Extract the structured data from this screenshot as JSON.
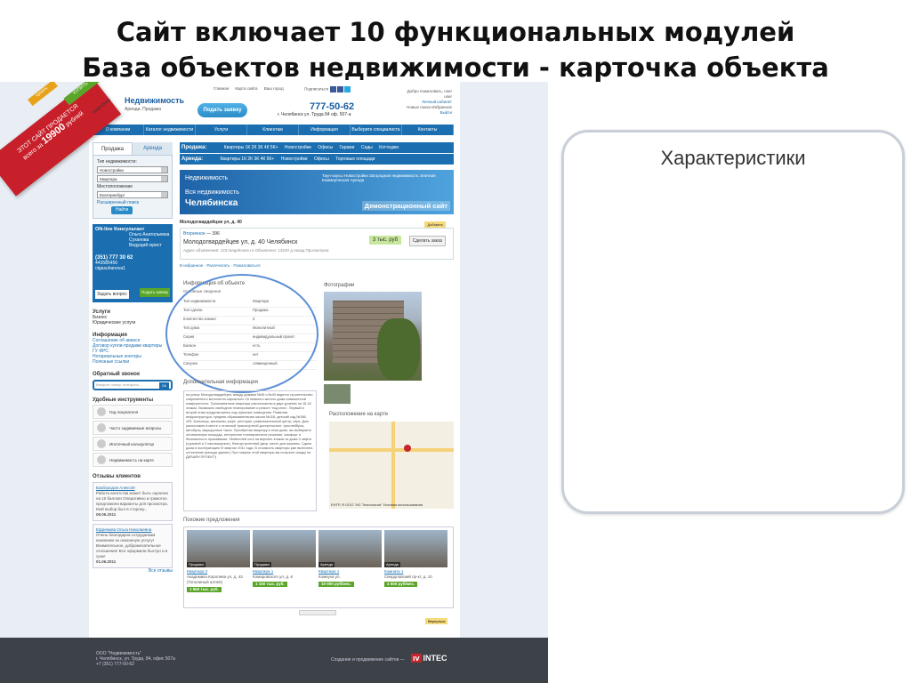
{
  "slide": {
    "title_line1": "Сайт включает 10 функциональных модулей",
    "title_line2": "База объектов недвижимости - карточка объекта",
    "right_panel_title": "Характеристики"
  },
  "site": {
    "promo_text_top": "ЭТОТ САЙТ ПРОДАЕТСЯ",
    "promo_text_mid": "всего за",
    "promo_price": "19900",
    "promo_price_unit": "рублей",
    "promo_btn_buy": "КУПИТЬ",
    "promo_btn_more": "подробнее",
    "promo_btn_green": "купить",
    "logo": "Недвижимость",
    "logo_sub": "Аренда. Продажа",
    "order_button": "Подать заявку",
    "top_links": [
      "Главная",
      "Карта сайта",
      "Ваш город"
    ],
    "social_label": "Подписаться",
    "phone": "777-50-62",
    "address": "г. Челябинск ул. Труда 84 оф. 507-а",
    "user_greeting": "Добро пожаловать, user",
    "user_name": "user",
    "user_links": [
      "Личный кабинет",
      "Новые поиск",
      "Избранное",
      "Выйти"
    ],
    "nav": [
      "О компании",
      "Каталог недвижимости",
      "Услуги",
      "Клиентам",
      "Информация",
      "Выберите специалиста",
      "Контакты"
    ],
    "tabs": {
      "sale": "Продажа",
      "rent": "Аренда"
    },
    "filters": {
      "type_label": "Тип недвижимости:",
      "type_value": "Новостройки",
      "kind_value": "Квартира",
      "location_label": "Местоположение",
      "location_value": "Екатеринбург",
      "advanced_link": "Расширенный поиск",
      "find_button": "Найти"
    },
    "online": {
      "title": "ON-line Консультант",
      "name": "Ольга Анатольевна Суханова",
      "position": "Ведущий юрист",
      "phone": "(351) 777 30 62",
      "icq": "443585456",
      "skype": "olgasuhanova1",
      "question_label": "Задать вопрос",
      "apply_label": "Подать заявку"
    },
    "services_title": "Услуги",
    "services": [
      "Бизнес",
      "Юридические услуги"
    ],
    "info_title": "Информация",
    "info_links": [
      "Соглашение об авансе",
      "Договор купли-продажи квартиры",
      "ГУ ФРС",
      "Нотариальные конторы",
      "Полезные ссылки"
    ],
    "callback_title": "Обратный звонок",
    "callback_placeholder": "Введите номер телефона...",
    "callback_btn": "Ok",
    "tools_title": "Удобные инструменты",
    "tools": [
      "Гид покупателя",
      "Часто задаваемые вопросы",
      "Ипотечный калькулятор",
      "Недвижимость на карте"
    ],
    "reviews_title": "Отзывы клиентов",
    "review1_name": "Базбородов Алексей",
    "review1_text": "Работа агентства может быть оценена на 10 баллов! Оперативно и грамотно предложили варианты для просмотра. Мой выбор был в сторону...",
    "review1_date": "09.06.2011",
    "review2_name": "Ефремова Ольга Николаевна",
    "review2_text": "Очень благодарна сотрудникам компании за оказанную услугу! Внимательное, доброжелательное отношение! Все оформили быстро и в срок!",
    "review2_date": "01.06.2011",
    "all_reviews": "Все отзывы",
    "deals": {
      "sale_label": "Продажа:",
      "rent_label": "Аренда:",
      "rooms": "Квартиры 1К 2К 3К 4К 5К+",
      "sale_extra": [
        "Новостройки",
        "Офисы",
        "Гаражи",
        "Сады",
        "Коттеджи"
      ],
      "rent_extra": [
        "Новостройки",
        "Офисы",
        "Торговые площади"
      ]
    },
    "banner": {
      "brand": "Недвижимость",
      "line1": "Вся недвижимость",
      "line2": "Челябинска",
      "demo": "Демонстрационный сайт",
      "links": "Таун-хаусы Новостройки Загородная недвижимость Элитная Коммерческая Аренда"
    },
    "object": {
      "title": "Молодогвардейцев ул, д. 40",
      "category": "Вторичное",
      "id": "396",
      "address": "Молодогвардейцев ул, д. 40 Челябинск",
      "object_address_label": "Адрес объявления:",
      "object_site": "123.megahouse.ru",
      "updated": "Обновлено: 13240 д назад",
      "views": "Просмотров:",
      "price": "3 тыс. руб",
      "deal_button": "Сделать заказ",
      "favorite": "Добавить",
      "actions": [
        "В избранное",
        "Распечатать",
        "Пожаловаться"
      ]
    },
    "info_header": "Информация об объекте",
    "info_subheader": "Основные сведения",
    "props": [
      [
        "Тип недвижимости",
        "Квартира"
      ],
      [
        "Тип сделки",
        "Продажа"
      ],
      [
        "Количество комнат",
        "3"
      ],
      [
        "Тип дома",
        "Монолитный"
      ],
      [
        "Серия",
        "индивидуальный проект"
      ],
      [
        "Балкон",
        "есть"
      ],
      [
        "Телефон",
        "нет"
      ],
      [
        "Санузел",
        "совмещенный"
      ]
    ],
    "photos_title": "Фотографии",
    "additional_title": "Дополнительная информация",
    "additional_text": "на улице Молодогвардейцев, между домами №36 и №40 ведется строительство современного монолитно-каркасного 16 этажного жилого дома повышенной комфортности. Трехкомнатные квартиры расположены в двух уровнях на 15-16 этажах. Возможно свободное планирование и ремонт 'под ключ'. Первый и второй этаж предусмотрены под офисные помещения. Развитая инфраструктура: средняя образовательная школа №118, детский сад №366, 425. Больница, магазины, кафе, ресторан, развлекательный центр, парк. Дом расположен в месте с отличной транспортной доступностью: троллейбусы, автобусы, маршрутные такси. Приобретая квартиру в этом доме, вы выбираете оптимальную площадь, интересное планировочное решение, комфорт и безопасность проживания. Любителей хоть на верхних этажах из дома 3 лифта (грузовой и 2 пассажирских), благоустроенный двор, место для машины. Сдача дома в эксплуатацию IV квартал 2011 года. В стоимость квартиры уже включена остекление фасада здания ( При покупке этой квартиры вы получите скидку на ДИЗАЙН ПРОЕКТ!)",
    "map_title": "Расположение на карте",
    "map_caption": "ЕНТР, Я ООО \"ИС Технологии\" Условия использования",
    "similar_title": "Похожие предложения",
    "similar": [
      {
        "tag": "Продажа",
        "name": "Квартира 2",
        "desc": "Академика Королева ул, д. 43 (Тополиный аллея)",
        "price": "1 960 тыс. руб."
      },
      {
        "tag": "Продажа",
        "name": "Квартира 1",
        "desc": "Комаровского ул, д. 6",
        "price": "1 150 тыс. руб."
      },
      {
        "tag": "Аренда",
        "name": "Квартира 1",
        "desc": "Комкуна ул.",
        "price": "10 000 руб/мес."
      },
      {
        "tag": "Аренда",
        "name": "Комната 1",
        "desc": "Свердловский пр-кт, д. 10",
        "price": "4 500 руб/мес."
      }
    ],
    "back_link": "Вернуться",
    "footer_company": "ООО \"Недвижимость\"",
    "footer_address": "г. Челябинск, ул. Труда, 84, офис 507а",
    "footer_phone": "+7 (351) 777-50-62",
    "footer_made": "Создание и продвижение сайтов —",
    "footer_brand": "INTEC"
  }
}
